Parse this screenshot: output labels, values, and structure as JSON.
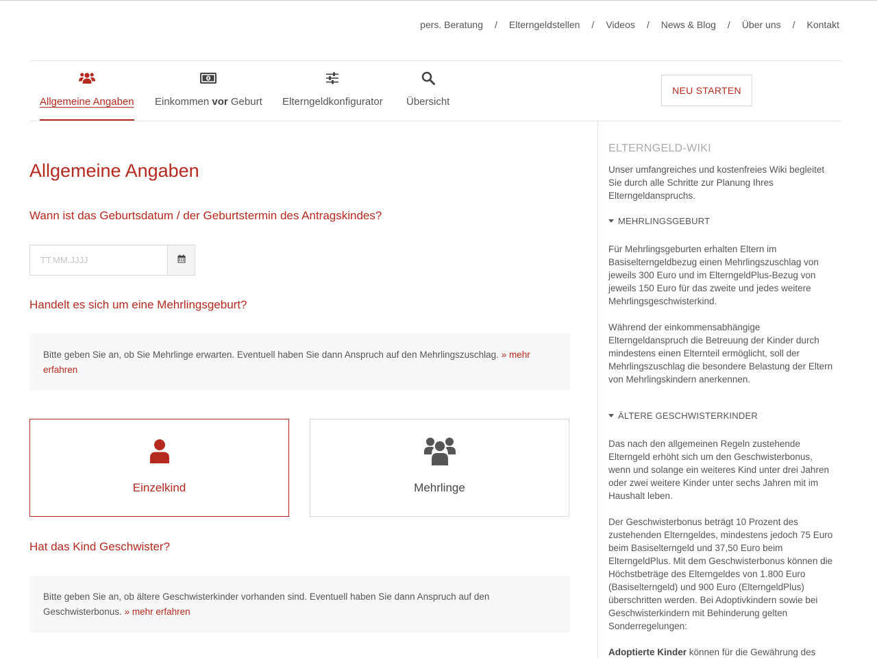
{
  "topnav": {
    "items": [
      "pers. Beratung",
      "Elterngeldstellen",
      "Videos",
      "News & Blog",
      "Über uns",
      "Kontakt"
    ],
    "separator": "/"
  },
  "steps": {
    "s1": "Allgemeine Angaben",
    "s2_pre": "Einkommen ",
    "s2_bold": "vor",
    "s2_post": " Geburt",
    "s3": "Elterngeldkonfigurator",
    "s4": "Übersicht"
  },
  "restart_label": "NEU STARTEN",
  "main": {
    "title": "Allgemeine Angaben",
    "q_birth": "Wann ist das Geburtsdatum / der Geburtstermin des Antragskindes?",
    "date_placeholder": "TT.MM.JJJJ",
    "q_multiple": "Handelt es sich um eine Mehrlingsgeburt?",
    "info_multiple": "Bitte geben Sie an, ob Sie Mehrlinge erwarten. Eventuell haben Sie dann Anspruch auf den Mehrlingszuschlag. ",
    "info_multiple_more": "» mehr erfahren",
    "choice_single": "Einzelkind",
    "choice_multi": "Mehrlinge",
    "q_siblings": "Hat das Kind Geschwister?",
    "info_siblings": "Bitte geben Sie an, ob ältere Geschwisterkinder vorhanden sind. Eventuell haben Sie dann Anspruch auf den Geschwisterbonus. ",
    "info_siblings_more": "» mehr erfahren"
  },
  "sidebar": {
    "title": "ELTERNGELD-WIKI",
    "intro": "Unser umfangreiches und kostenfreies Wiki begleitet Sie durch alle Schritte zur Planung Ihres Elterngeldanspruchs.",
    "sec1": "MEHRLINGSGEBURT",
    "sec1_p1": "Für Mehrlingsgeburten erhalten Eltern im Basiselterngeldbezug einen Mehrlingszuschlag von jeweils 300 Euro und im ElterngeldPlus-Bezug von jeweils 150 Euro für das zweite und jedes weitere Mehrlingsgeschwisterkind.",
    "sec1_p2": "Während der einkommensabhängige Elterngeldanspruch die Betreuung der Kinder durch mindestens einen Elternteil ermöglicht, soll der Mehrlingszuschlag die besondere Belastung der Eltern von Mehrlingskindern anerkennen.",
    "sec2": "ÄLTERE GESCHWISTERKINDER",
    "sec2_p1": "Das nach den allgemeinen Regeln zustehende Elterngeld erhöht sich um den Geschwisterbonus, wenn und solange ein weiteres Kind unter drei Jahren oder zwei weitere Kinder unter sechs Jahren mit im Haushalt leben.",
    "sec2_p2": "Der Geschwisterbonus beträgt 10 Prozent des zustehenden Elterngeldes, mindestens jedoch 75 Euro beim Basiselterngeld und 37,50 Euro beim ElterngeldPlus. Mit dem Geschwisterbonus können die Höchstbeträge des Elterngeldes von 1.800 Euro (Basiselterngeld) und 900 Euro (ElterngeldPlus) überschritten werden. Bei Adoptivkindern sowie bei Geschwisterkindern mit Behinderung gelten Sonderregelungen:",
    "sec2_p3_bold": "Adoptierte Kinder",
    "sec2_p3_rest": " können für die Gewährung des"
  },
  "colors": {
    "accent": "#b5291f",
    "text": "#555555",
    "muted": "#aaaaaa"
  },
  "icons": {
    "step1": "users-icon",
    "step2": "money-bill-icon",
    "step3": "sliders-icon",
    "step4": "search-icon",
    "date": "calendar-icon",
    "single": "user-icon",
    "multi": "users-icon"
  }
}
